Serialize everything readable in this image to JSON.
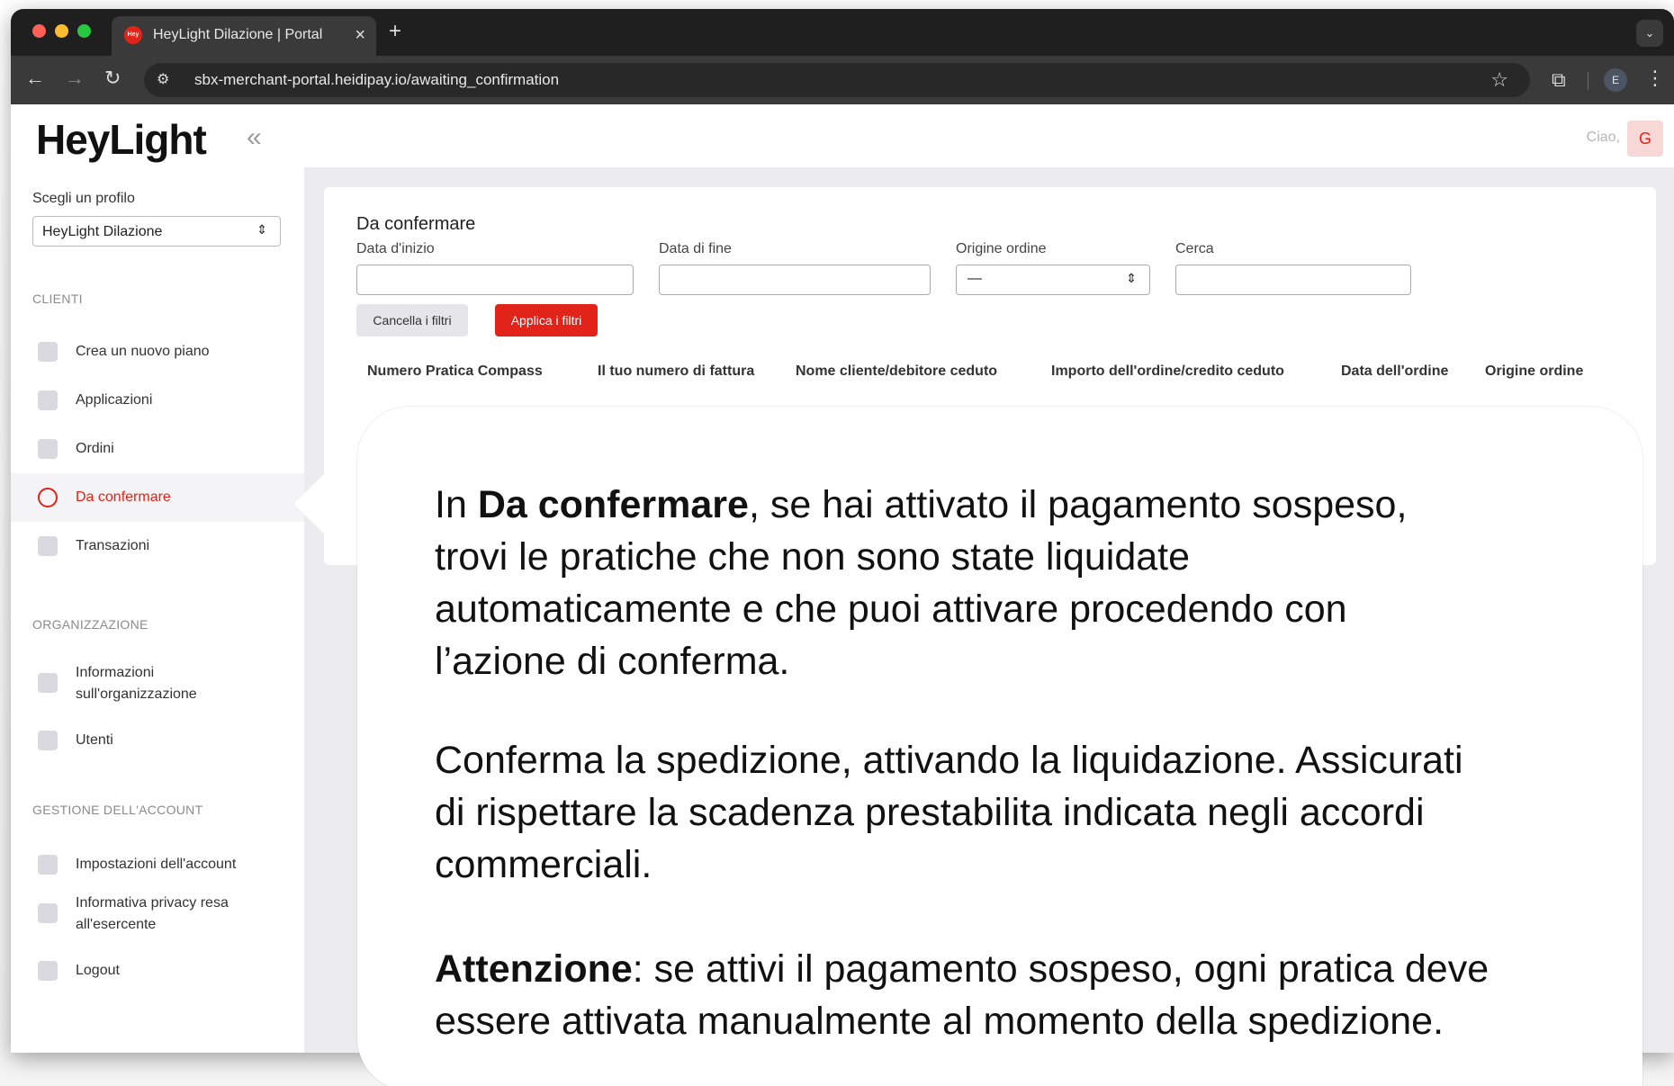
{
  "browser": {
    "tab_title": "HeyLight Dilazione | Portal",
    "tab_favicon": "Hey",
    "url": "sbx-merchant-portal.heidipay.io/awaiting_confirmation",
    "profile_initial": "E"
  },
  "sidebar": {
    "logo": "HeyLight",
    "profile_label": "Scegli un profilo",
    "profile_value": "HeyLight Dilazione",
    "sections": {
      "clienti": "CLIENTI",
      "organizzazione": "ORGANIZZAZIONE",
      "account": "GESTIONE DELL'ACCOUNT"
    },
    "items": {
      "new_plan": "Crea un nuovo piano",
      "applications": "Applicazioni",
      "orders": "Ordini",
      "to_confirm": "Da confermare",
      "transactions": "Transazioni",
      "org_info_1": "Informazioni",
      "org_info_2": "sull'organizzazione",
      "users": "Utenti",
      "account_settings": "Impostazioni dell'account",
      "privacy_1": "Informativa privacy resa",
      "privacy_2": "all'esercente",
      "logout": "Logout"
    }
  },
  "header": {
    "greeting": "Ciao,",
    "avatar_initial": "G"
  },
  "main": {
    "title": "Da confermare",
    "filters": {
      "start_date": "Data d'inizio",
      "end_date": "Data di fine",
      "order_origin": "Origine ordine",
      "order_origin_value": "—",
      "search": "Cerca"
    },
    "buttons": {
      "clear": "Cancella i filtri",
      "apply": "Applica i filtri"
    },
    "table_headers": [
      "Numero Pratica Compass",
      "Il tuo numero di fattura",
      "Nome cliente/debitore ceduto",
      "Importo dell'ordine/credito ceduto",
      "Data dell'ordine",
      "Origine ordine"
    ]
  },
  "callout": {
    "p1_a": "In ",
    "p1_bold": "Da confermare",
    "p1_l1": ", se hai attivato il pagamento sospeso,",
    "p1_l2": "trovi le pratiche che non sono state liquidate",
    "p1_l3": "automaticamente e che puoi attivare procedendo con",
    "p1_l4": "l’azione di conferma.",
    "p2_l1": "Conferma la spedizione, attivando la liquidazione. Assicurati",
    "p2_l2": "di rispettare la scadenza prestabilita indicata negli accordi",
    "p2_l3": "commerciali.",
    "p3_bold": "Attenzione",
    "p3_l1": ": se attivi il pagamento sospeso, ogni pratica deve",
    "p3_l2": "essere attivata manualmente al momento della spedizione."
  },
  "colors": {
    "brand_red": "#e2231a",
    "chrome_dark": "#1f1f1f"
  }
}
